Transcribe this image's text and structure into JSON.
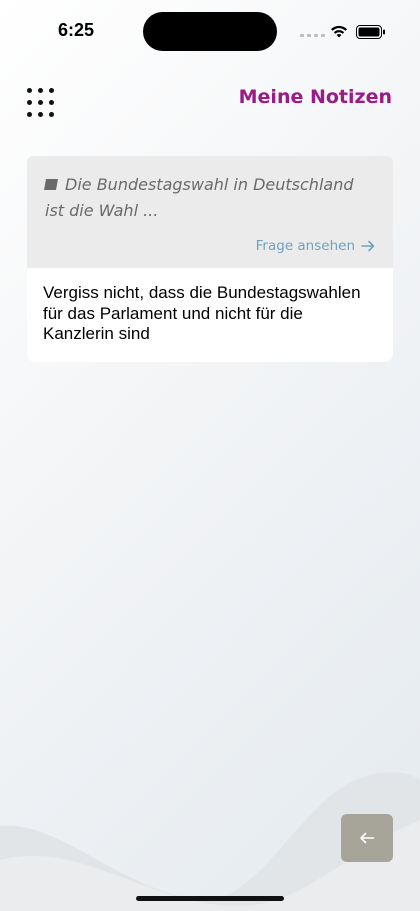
{
  "status_bar": {
    "time": "6:25",
    "icons": [
      "cellular-signal-icon",
      "wifi-icon",
      "battery-icon"
    ]
  },
  "header": {
    "menu_icon": "grid-menu-icon",
    "title": "Meine Notizen",
    "title_color": "#9a1a86"
  },
  "notes": [
    {
      "question_icon": "question-marker-icon",
      "question_excerpt": "Die Bundestagswahl in Deutschland ist die Wahl ...",
      "view_link_label": "Frage ansehen",
      "view_link_icon": "arrow-right-icon",
      "note_text": "Vergiss nicht, dass die Bundestagswahlen für das Parlament und nicht für die Kanzlerin sind"
    }
  ],
  "footer": {
    "back_icon": "arrow-left-icon",
    "back_button_color": "#a7a49a"
  },
  "colors": {
    "accent": "#9a1a86",
    "link": "#6fa3bd",
    "question_bg": "#ebebeb"
  }
}
